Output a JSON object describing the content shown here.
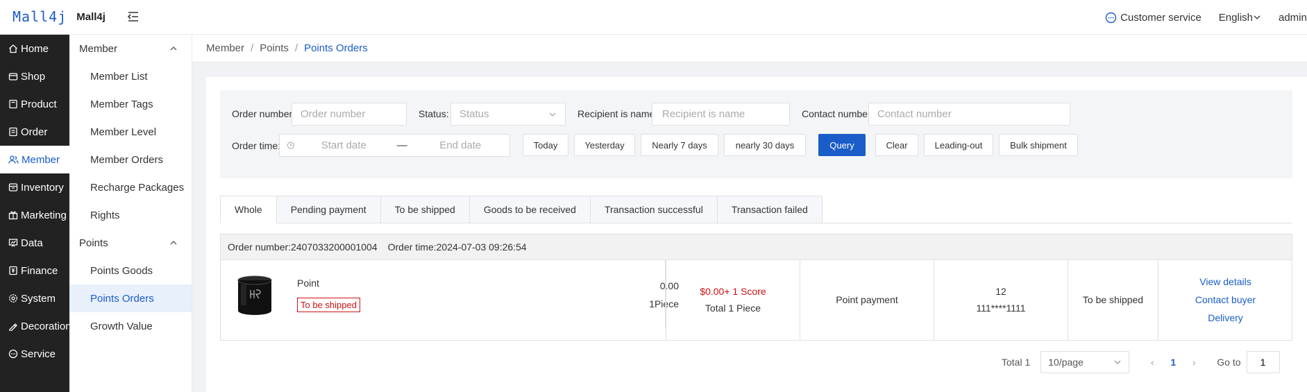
{
  "header": {
    "logo_mark": "Mall4j",
    "logo_text": "Mall4j",
    "customer_service": "Customer service",
    "language": "English",
    "user": "admin"
  },
  "sidebar": {
    "items": [
      {
        "label": "Home",
        "icon": "home-icon"
      },
      {
        "label": "Shop",
        "icon": "shop-icon"
      },
      {
        "label": "Product",
        "icon": "product-icon"
      },
      {
        "label": "Order",
        "icon": "order-icon"
      },
      {
        "label": "Member",
        "icon": "member-icon",
        "active": true
      },
      {
        "label": "Inventory",
        "icon": "inventory-icon"
      },
      {
        "label": "Marketing",
        "icon": "marketing-icon"
      },
      {
        "label": "Data",
        "icon": "data-icon"
      },
      {
        "label": "Finance",
        "icon": "finance-icon"
      },
      {
        "label": "System",
        "icon": "system-icon"
      },
      {
        "label": "Decoration",
        "icon": "decoration-icon"
      },
      {
        "label": "Service",
        "icon": "service-icon"
      }
    ]
  },
  "submenu": {
    "member_group": "Member",
    "member_items": [
      "Member List",
      "Member Tags",
      "Member Level",
      "Member Orders",
      "Recharge Packages",
      "Rights"
    ],
    "points_group": "Points",
    "points_items": [
      "Points Goods",
      "Points Orders",
      "Growth Value"
    ],
    "active": "Points Orders"
  },
  "breadcrumb": [
    "Member",
    "Points",
    "Points Orders"
  ],
  "search": {
    "order_number_label": "Order number:",
    "order_number_placeholder": "Order number",
    "status_label": "Status:",
    "status_placeholder": "Status",
    "recipient_label": "Recipient is name:",
    "recipient_placeholder": "Recipient is name",
    "contact_label": "Contact number:",
    "contact_placeholder": "Contact number",
    "order_time_label": "Order time:",
    "start_date": "Start date",
    "date_sep": "—",
    "end_date": "End date",
    "today": "Today",
    "yesterday": "Yesterday",
    "nearly_7": "Nearly 7 days",
    "nearly_30": "nearly 30 days",
    "query": "Query",
    "clear": "Clear",
    "leading_out": "Leading-out",
    "bulk_shipment": "Bulk shipment"
  },
  "tabs": [
    "Whole",
    "Pending payment",
    "To be shipped",
    "Goods to be received",
    "Transaction successful",
    "Transaction failed"
  ],
  "order": {
    "number_label": "Order number:",
    "number": "2407033200001004",
    "time_label": "Order time:",
    "time": "2024-07-03 09:26:54",
    "product_name": "Point",
    "product_status": "To be shipped",
    "price": "0.00",
    "quantity": "1Piece",
    "amount": "$0.00+ 1 Score",
    "total": "Total 1 Piece",
    "payment": "Point payment",
    "recipient": "12",
    "phone": "111****1111",
    "status": "To be shipped",
    "actions": [
      "View details",
      "Contact buyer",
      "Delivery"
    ]
  },
  "pagination": {
    "total": "Total 1",
    "page_size": "10/page",
    "current": "1",
    "goto_label": "Go to",
    "goto_value": "1"
  },
  "colors": {
    "accent": "#1a5cc8",
    "sidebar_bg": "#222222",
    "danger": "#d01010"
  }
}
